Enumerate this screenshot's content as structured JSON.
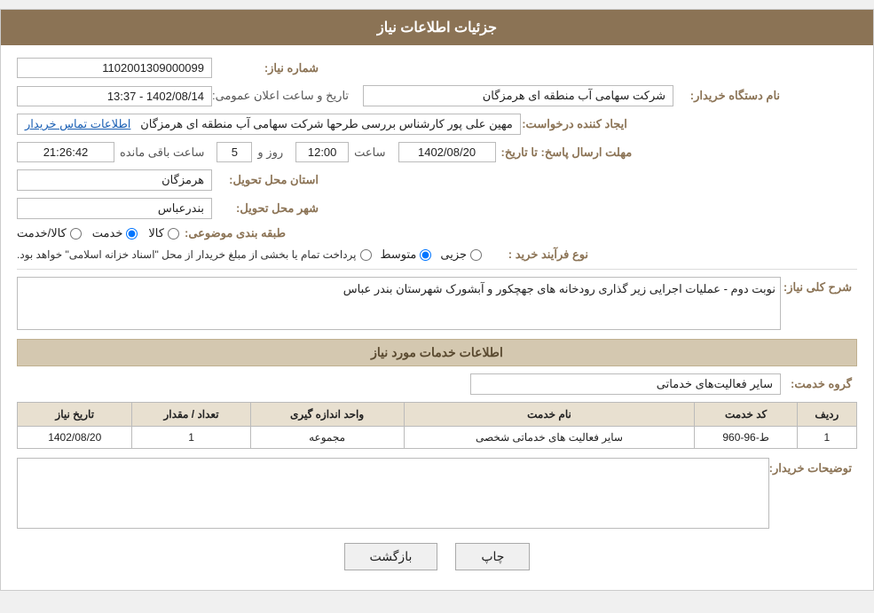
{
  "header": {
    "title": "جزئیات اطلاعات نیاز"
  },
  "form": {
    "need_number_label": "شماره نیاز:",
    "need_number_value": "1102001309000099",
    "organization_label": "نام دستگاه خریدار:",
    "organization_value": "شرکت سهامی  آب منطقه ای هرمزگان",
    "announce_datetime_label": "تاریخ و ساعت اعلان عمومی:",
    "announce_datetime_value": "1402/08/14 - 13:37",
    "creator_label": "ایجاد کننده درخواست:",
    "creator_value": "مهین علی پور کارشناس بررسی طرحها شرکت سهامی  آب منطقه ای هرمزگان",
    "creator_link": "اطلاعات تماس خریدار",
    "deadline_label": "مهلت ارسال پاسخ: تا تاریخ:",
    "deadline_date": "1402/08/20",
    "deadline_time_label": "ساعت",
    "deadline_time": "12:00",
    "deadline_day_label": "روز و",
    "deadline_days": "5",
    "deadline_remaining_label": "ساعت باقی مانده",
    "deadline_remaining": "21:26:42",
    "province_label": "استان محل تحویل:",
    "province_value": "هرمزگان",
    "city_label": "شهر محل تحویل:",
    "city_value": "بندرعباس",
    "category_label": "طبقه بندی موضوعی:",
    "category_options": [
      {
        "value": "کالا",
        "checked": false
      },
      {
        "value": "خدمت",
        "checked": true
      },
      {
        "value": "کالا/خدمت",
        "checked": false
      }
    ],
    "procure_label": "نوع فرآیند خرید :",
    "procure_options": [
      {
        "value": "جزیی",
        "checked": false
      },
      {
        "value": "متوسط",
        "checked": true
      },
      {
        "value": "پرداخت تمام یا بخشی از مبلغ خریدار از محل \"اسناد خزانه اسلامی\" خواهد بود.",
        "checked": false
      }
    ],
    "description_label": "شرح کلی نیاز:",
    "description_value": "نوبت دوم - عملیات اجرایی زیر گذاری رودخانه های جهچکور و آبشورک شهرستان بندر عباس",
    "services_section_title": "اطلاعات خدمات مورد نیاز",
    "service_group_label": "گروه خدمت:",
    "service_group_value": "سایر فعالیت‌های خدماتی",
    "table": {
      "columns": [
        "ردیف",
        "کد خدمت",
        "نام خدمت",
        "واحد اندازه گیری",
        "تعداد / مقدار",
        "تاریخ نیاز"
      ],
      "rows": [
        {
          "row": "1",
          "code": "ط-96-960",
          "name": "سایر فعالیت های خدماتی شخصی",
          "unit": "مجموعه",
          "quantity": "1",
          "date": "1402/08/20"
        }
      ]
    },
    "buyer_notes_label": "توضیحات خریدار:",
    "buyer_notes_value": ""
  },
  "buttons": {
    "print": "چاپ",
    "back": "بازگشت"
  }
}
